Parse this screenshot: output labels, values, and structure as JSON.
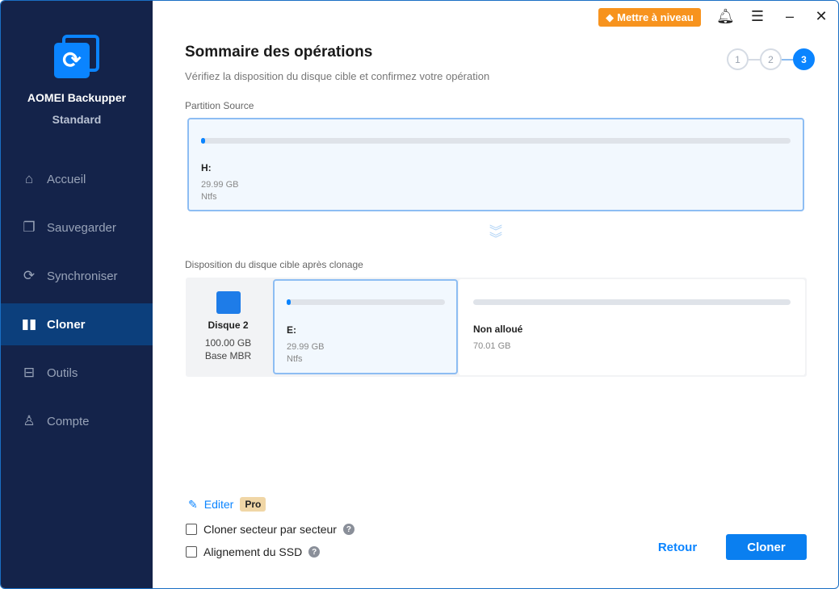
{
  "app": {
    "name": "AOMEI Backupper",
    "edition": "Standard"
  },
  "sidebar": {
    "items": [
      {
        "label": "Accueil",
        "icon": "home-icon"
      },
      {
        "label": "Sauvegarder",
        "icon": "backup-icon"
      },
      {
        "label": "Synchroniser",
        "icon": "sync-icon"
      },
      {
        "label": "Cloner",
        "icon": "clone-icon",
        "active": true
      },
      {
        "label": "Outils",
        "icon": "toolbox-icon"
      },
      {
        "label": "Compte",
        "icon": "user-icon"
      }
    ]
  },
  "topbar": {
    "upgrade_label": "Mettre à niveau"
  },
  "header": {
    "title": "Sommaire des opérations",
    "subtitle": "Vérifiez la disposition du disque cible et confirmez votre opération"
  },
  "steps": [
    "1",
    "2",
    "3"
  ],
  "current_step": 3,
  "source": {
    "label": "Partition Source",
    "name": "H:",
    "size": "29.99 GB",
    "fs": "Ntfs",
    "used_fraction": 0.005
  },
  "target": {
    "label": "Disposition du disque cible après clonage",
    "disk": {
      "name": "Disque 2",
      "size": "100.00 GB",
      "type": "Base MBR"
    },
    "partition": {
      "name": "E:",
      "size": "29.99 GB",
      "fs": "Ntfs",
      "used_fraction": 0.01
    },
    "unallocated": {
      "name": "Non alloué",
      "size": "70.01 GB"
    }
  },
  "options": {
    "edit_label": "Editer",
    "pro_badge": "Pro",
    "sector_label": "Cloner secteur par secteur",
    "ssd_label": "Alignement du SSD",
    "help": "?"
  },
  "buttons": {
    "back": "Retour",
    "clone": "Cloner"
  },
  "colors": {
    "accent": "#0a84ff",
    "sidebar": "#14234a",
    "upgrade": "#f7931e"
  }
}
